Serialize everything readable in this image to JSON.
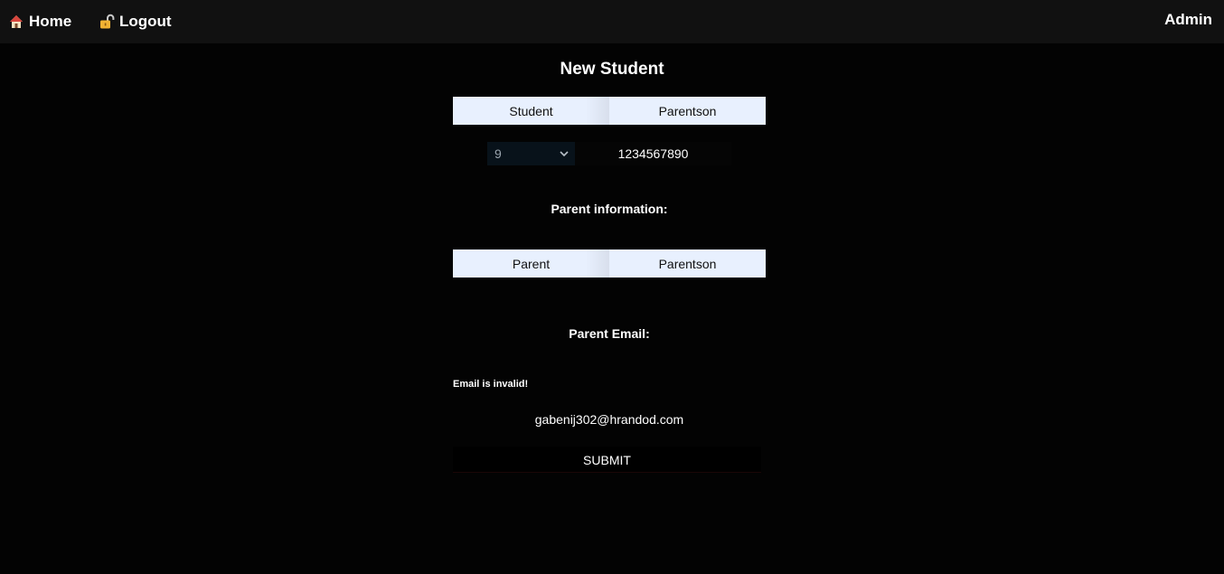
{
  "navbar": {
    "home_label": "Home",
    "home_icon": "house-icon",
    "logout_label": "Logout",
    "logout_icon": "unlocked-padlock-icon",
    "user_label": "Admin",
    "background": "#111111"
  },
  "page": {
    "title": "New Student",
    "background": "#030303"
  },
  "student": {
    "first_name_value": "Student",
    "last_name_value": "Parentson",
    "grade_value": "9",
    "phone_value": "1234567890"
  },
  "parent_info": {
    "label": "Parent information:",
    "first_name_value": "Parent",
    "last_name_value": "Parentson"
  },
  "parent_email": {
    "label": "Parent Email:",
    "error_text": "Email is invalid!",
    "value": "gabenij302@hrandod.com"
  },
  "form": {
    "submit_label": "SUBMIT"
  },
  "colors": {
    "autofill_input_bg": "#e8f0fe",
    "text": "#ffffff"
  }
}
